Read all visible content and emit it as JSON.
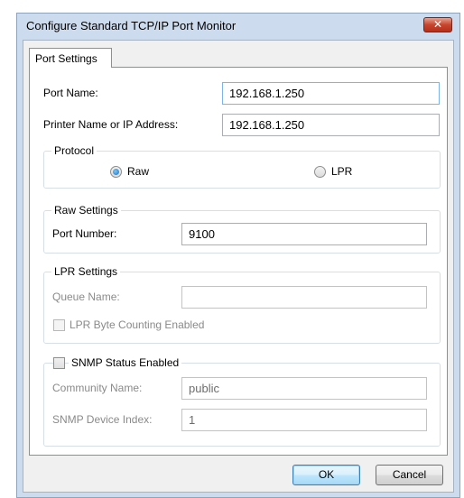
{
  "window": {
    "title": "Configure Standard TCP/IP Port Monitor",
    "close_glyph": "✕"
  },
  "tabs": [
    {
      "label": "Port Settings"
    }
  ],
  "port_name": {
    "label": "Port Name:",
    "value": "192.168.1.250"
  },
  "printer_address": {
    "label": "Printer Name or IP Address:",
    "value": "192.168.1.250"
  },
  "protocol": {
    "legend": "Protocol",
    "options": [
      {
        "label": "Raw",
        "selected": true
      },
      {
        "label": "LPR",
        "selected": false
      }
    ]
  },
  "raw_settings": {
    "legend": "Raw Settings",
    "port_number_label": "Port Number:",
    "port_number_value": "9100"
  },
  "lpr_settings": {
    "legend": "LPR Settings",
    "queue_name_label": "Queue Name:",
    "queue_name_value": "",
    "byte_counting_label": "LPR Byte Counting Enabled"
  },
  "snmp": {
    "enabled_label": "SNMP Status Enabled",
    "community_name_label": "Community Name:",
    "community_name_value": "public",
    "device_index_label": "SNMP Device Index:",
    "device_index_value": "1"
  },
  "buttons": {
    "ok": "OK",
    "cancel": "Cancel"
  }
}
